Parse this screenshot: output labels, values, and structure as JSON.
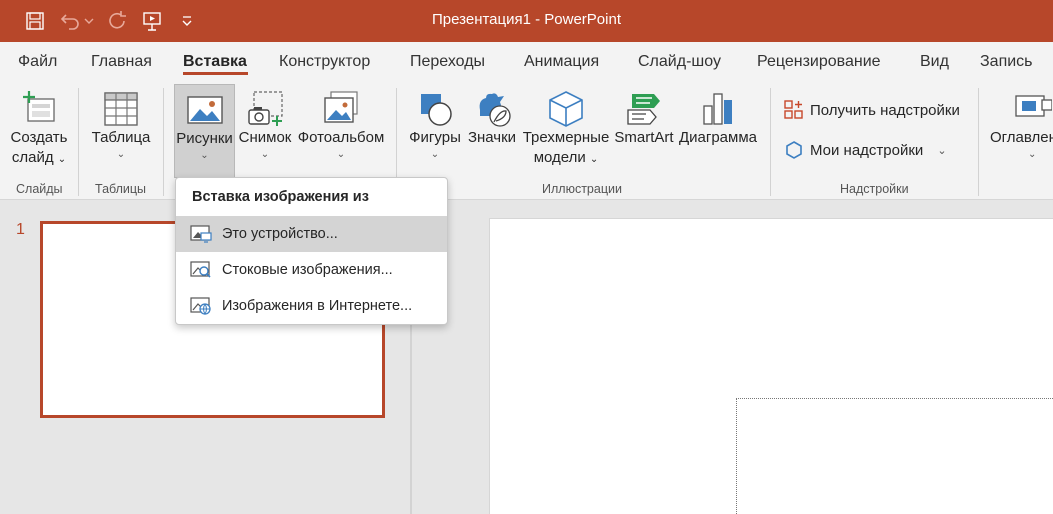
{
  "window": {
    "title": "Презентация1 - PowerPoint",
    "accent_color": "#b7472a"
  },
  "quick_access": [
    {
      "name": "save-icon"
    },
    {
      "name": "undo-icon"
    },
    {
      "name": "redo-icon"
    },
    {
      "name": "present-from-start-icon"
    },
    {
      "name": "customize-qat-icon"
    }
  ],
  "tabs": [
    "Файл",
    "Главная",
    "Вставка",
    "Конструктор",
    "Переходы",
    "Анимация",
    "Слайд-шоу",
    "Рецензирование",
    "Вид",
    "Запись"
  ],
  "active_tab": "Вставка",
  "ribbon": {
    "new_slide": {
      "line1": "Создать",
      "line2": "слайд"
    },
    "table": {
      "label": "Таблица"
    },
    "pictures": {
      "label": "Рисунки"
    },
    "screenshot": {
      "label": "Снимок"
    },
    "photo_album": {
      "label": "Фотоальбом"
    },
    "shapes": {
      "label": "Фигуры"
    },
    "icons": {
      "label": "Значки"
    },
    "models3d": {
      "line1": "Трехмерные",
      "line2": "модели"
    },
    "smartart": {
      "label": "SmartArt"
    },
    "chart": {
      "label": "Диаграмма"
    },
    "get_addins": {
      "label": "Получить надстройки"
    },
    "my_addins": {
      "label": "Мои надстройки"
    },
    "toc": {
      "label": "Оглавлен"
    },
    "groups": {
      "slides": "Слайды",
      "tables": "Таблицы",
      "illustrations": "Иллюстрации",
      "addins": "Надстройки"
    }
  },
  "dropdown": {
    "header": "Вставка изображения из",
    "items": [
      {
        "label": "Это устройство...",
        "icon": "device-picture-icon",
        "hover": true
      },
      {
        "label": "Стоковые изображения...",
        "icon": "stock-images-icon",
        "hover": false
      },
      {
        "label": "Изображения в Интернете...",
        "icon": "online-pictures-icon",
        "hover": false
      }
    ]
  },
  "slides": {
    "current_number": "1"
  }
}
